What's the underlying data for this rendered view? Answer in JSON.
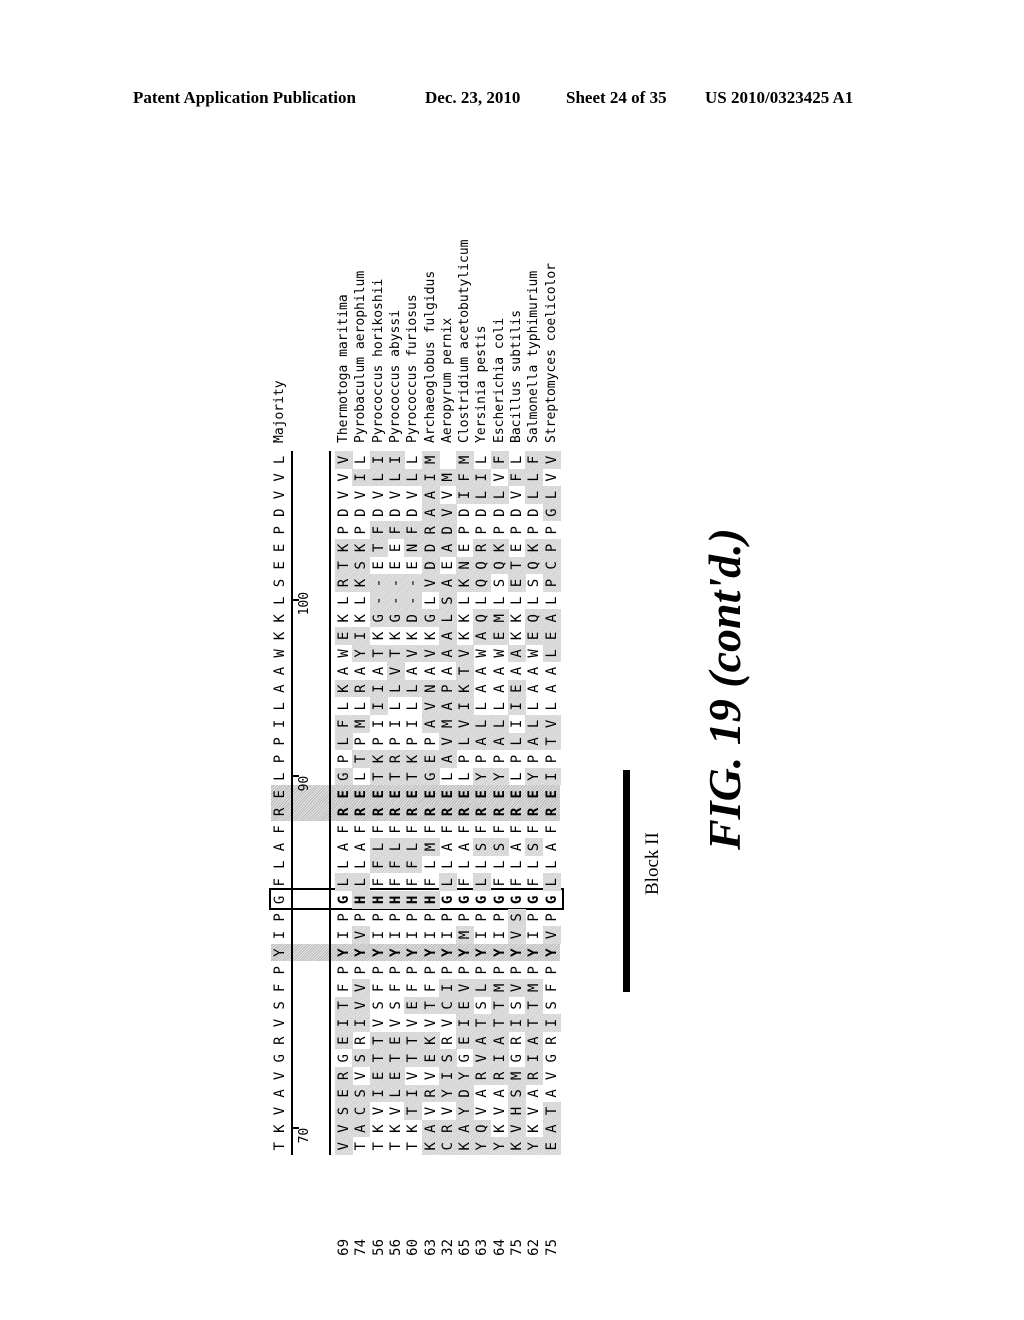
{
  "header": {
    "publication": "Patent Application Publication",
    "date": "Dec. 23, 2010",
    "sheet": "Sheet 24 of 35",
    "number": "US 2010/0323425 A1"
  },
  "alignment": {
    "majority_label": "Majority",
    "majority": "TKVAVGRVSFPYIPGFLAFRELPPILAAWKKLSEEPDVVL",
    "ruler": [
      {
        "position": 70,
        "label": "70"
      },
      {
        "position": 90,
        "label": "90"
      },
      {
        "position": 100,
        "label": "100"
      }
    ],
    "conserved_columns": [
      12,
      20,
      21
    ],
    "boxed_column": 15,
    "sequences": [
      {
        "start": "69",
        "name": "Thermotoga maritima",
        "seq": "VVSERGEITFPYIPGLLAFREGPLFLKAWEKLRTKPDVVV"
      },
      {
        "start": "74",
        "name": "Pyrobaculum aerophilum",
        "seq": "TACSVSRIVVPYVPHLLAFRELTPMLRAYIKLKSKPDVIL"
      },
      {
        "start": "56",
        "name": "Pyrococcus horikoshii",
        "seq": "TKVIETTVSFPYIPHFFLFRETKPIIIATKG--ETFDVLI"
      },
      {
        "start": "56",
        "name": "Pyrococcus abyssi",
        "seq": "TKVLETEVSFPYIPHFFLFRETRPILLVTKG--EEFDVLI"
      },
      {
        "start": "60",
        "name": "Pyrococcus furiosus",
        "seq": "TKTIVTTVEFPYIPHFFLFRETKPILLAVKD--ENFDVLL"
      },
      {
        "start": "63",
        "name": "Archaeoglobus fulgidus",
        "seq": "KAVRVEKVTFPYIPHFLMFREGEPAVNAVKGLVDDRAAIM"
      },
      {
        "start": "32",
        "name": "Aeropyrum pernix",
        "seq": "CRVYISRVCIPYIPGLLAFRELAVMAPAAALSAEADVVM"
      },
      {
        "start": "65",
        "name": "Clostridium acetobutylicum",
        "seq": "KAYDYGEIEVPYMPGFLAFRELPLVIKTVKKLKNEPDIFM"
      },
      {
        "start": "63",
        "name": "Yersinia pestis",
        "seq": "YQVARVATSLPYIPGLLSFREYPALLAAWAQLQQRPDLIL"
      },
      {
        "start": "64",
        "name": "Escherichia coli",
        "seq": "YKVARIATTMPYIPGFLSFREYPALLAAWEMLSQKPDLVF"
      },
      {
        "start": "75",
        "name": "Bacillus subtilis",
        "seq": "KVHSMGRISVPYVSGFLAFRELPLIIEAAKKLETEPDVFL"
      },
      {
        "start": "62",
        "name": "Salmonella typhimurium",
        "seq": "YKVARIATTMPYIPGFLSFREYPALLAAWEQLSQKPDLLF"
      },
      {
        "start": "75",
        "name": "Streptomyces coelicolor",
        "seq": "EATAVGRISFPYVPGLLAFREIPTVLAALEALPCPPGLVV"
      }
    ]
  },
  "annotations": {
    "block_label": "Block II",
    "figure_label": "FIG.  19 (cont'd.)"
  }
}
